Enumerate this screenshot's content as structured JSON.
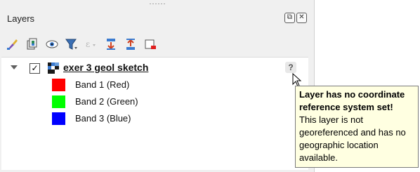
{
  "panel": {
    "title": "Layers",
    "window_buttons": [
      {
        "name": "float-icon",
        "glyph": "⧉"
      },
      {
        "name": "close-icon",
        "glyph": "✕"
      }
    ]
  },
  "toolbar": {
    "buttons": [
      {
        "name": "style-brush-icon"
      },
      {
        "name": "add-group-icon"
      },
      {
        "name": "visibility-eye-icon"
      },
      {
        "name": "filter-funnel-icon"
      },
      {
        "name": "expression-filter-icon"
      },
      {
        "name": "expand-all-icon"
      },
      {
        "name": "collapse-all-icon"
      },
      {
        "name": "remove-layer-icon"
      }
    ]
  },
  "layers": [
    {
      "name": "exer 3 geol sketch",
      "checked_glyph": "✓",
      "warning_glyph": "?",
      "bands": [
        {
          "label": "Band 1 (Red)",
          "color": "#ff0000"
        },
        {
          "label": "Band 2 (Green)",
          "color": "#00ff00"
        },
        {
          "label": "Band 3 (Blue)",
          "color": "#0000ff"
        }
      ]
    }
  ],
  "tooltip": {
    "title": "Layer has no coordinate reference system set!",
    "body": "This layer is not georeferenced and has no geographic location available."
  }
}
